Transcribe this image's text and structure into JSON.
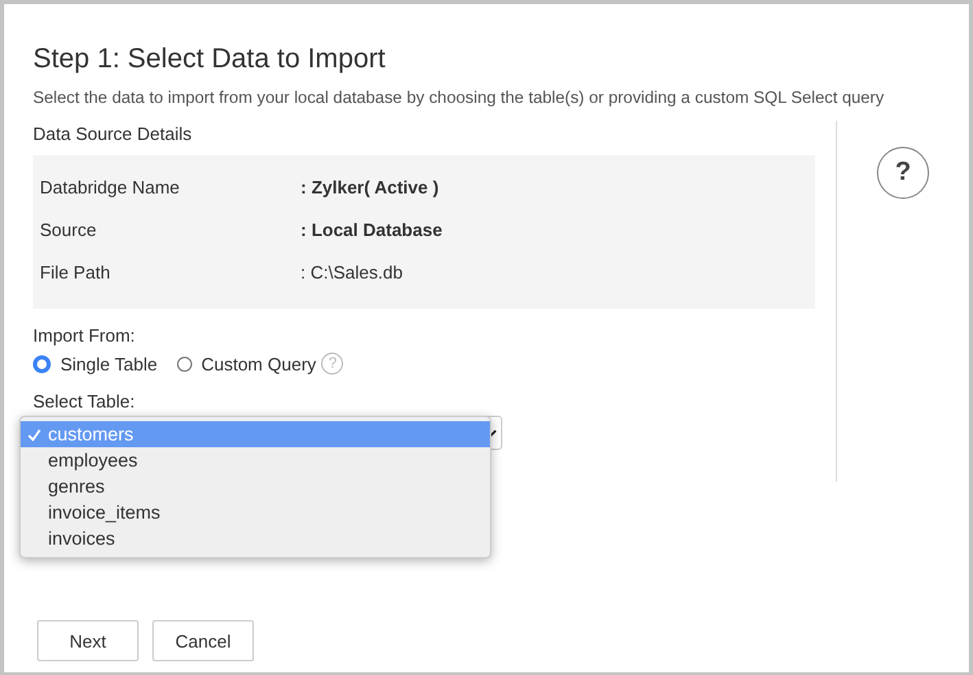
{
  "title": "Step 1: Select Data to Import",
  "description": "Select the data to import from your local database by choosing the table(s) or providing a custom SQL Select query",
  "details": {
    "heading": "Data Source Details",
    "rows": [
      {
        "label": "Databridge Name",
        "value": ": Zylker( Active )"
      },
      {
        "label": "Source",
        "value": ": Local Database"
      },
      {
        "label": "File Path",
        "value": ": C:\\Sales.db"
      }
    ]
  },
  "import_from": {
    "label": "Import From:",
    "options": [
      {
        "label": "Single Table",
        "selected": true
      },
      {
        "label": "Custom Query",
        "selected": false,
        "help": "?"
      }
    ]
  },
  "help_button": "?",
  "select_table": {
    "label": "Select Table:",
    "options": [
      {
        "label": "customers",
        "selected": true
      },
      {
        "label": "employees",
        "selected": false
      },
      {
        "label": "genres",
        "selected": false
      },
      {
        "label": "invoice_items",
        "selected": false
      },
      {
        "label": "invoices",
        "selected": false
      }
    ]
  },
  "buttons": [
    "Next",
    "Cancel"
  ]
}
